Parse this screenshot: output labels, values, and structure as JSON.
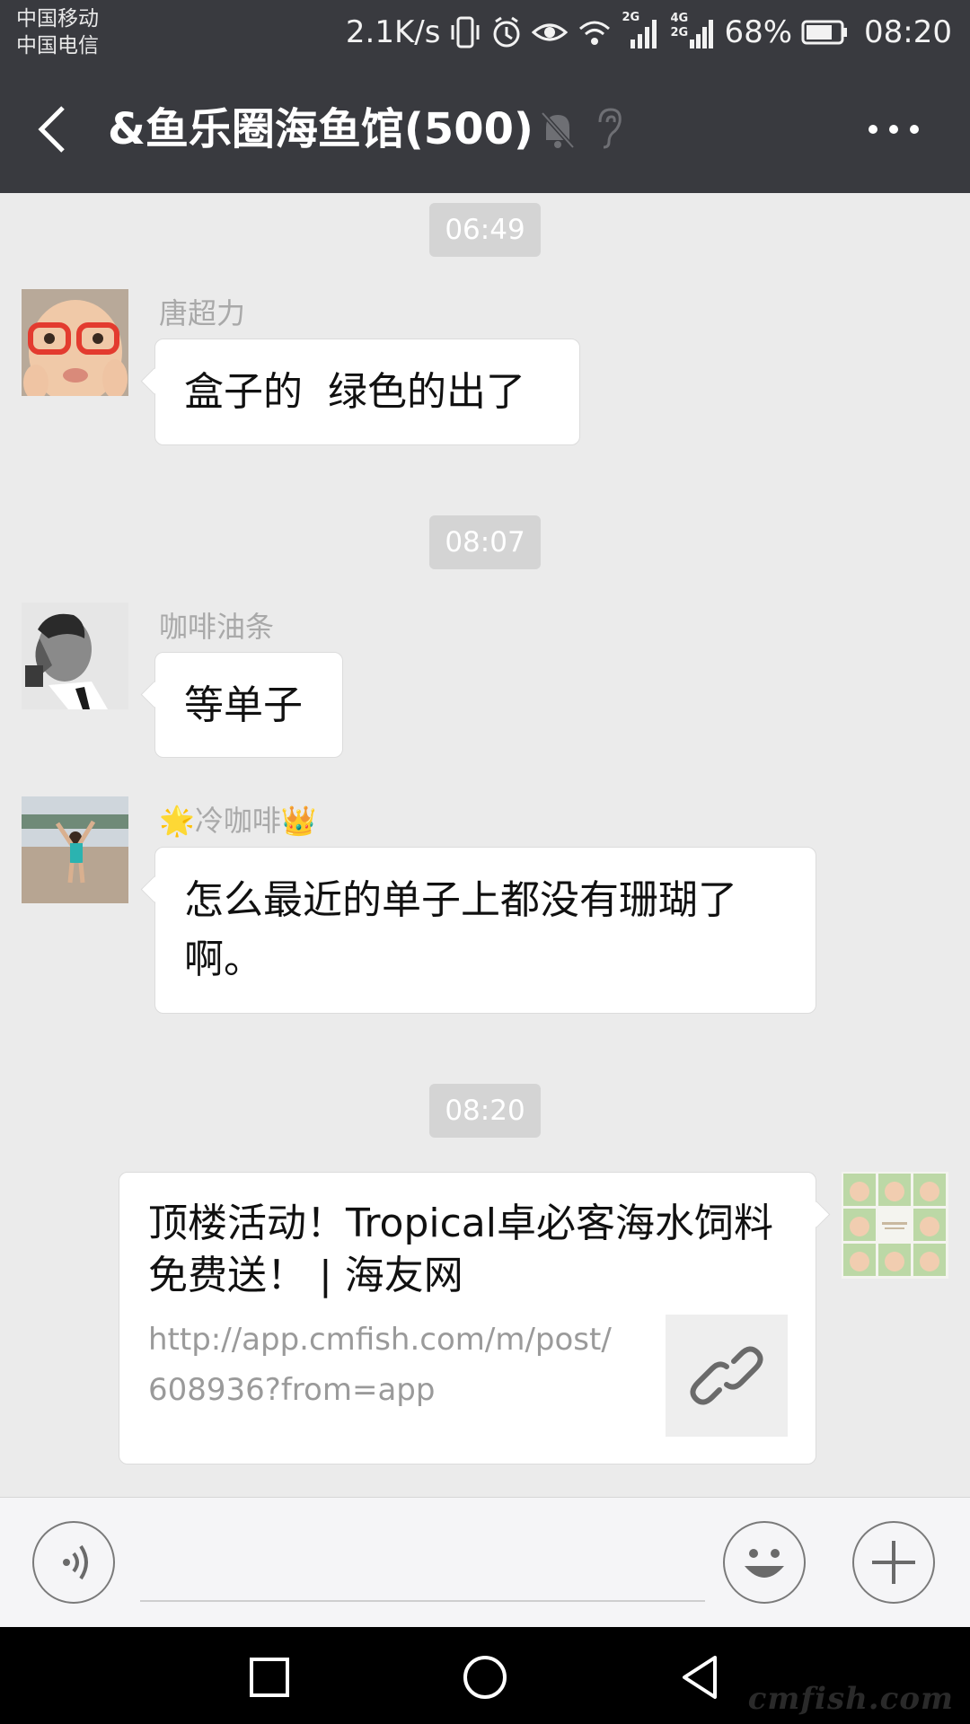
{
  "status_bar": {
    "carrier_1": "中国移动",
    "carrier_2": "中国电信",
    "net_speed": "2.1K/s",
    "sim1_tag": "2G",
    "sim2_tag_top": "4G",
    "sim2_tag_bottom": "2G",
    "battery_pct": "68%",
    "time": "08:20",
    "icons": [
      "vibrate-icon",
      "alarm-icon",
      "eye-icon",
      "wifi-icon",
      "signal-icon",
      "signal-icon",
      "battery-icon"
    ]
  },
  "header": {
    "title": "&鱼乐圈海鱼馆(500)",
    "icons": [
      "back-arrow-icon",
      "mute-bell-icon",
      "ear-icon",
      "more-dots-icon"
    ]
  },
  "chat": {
    "timestamps": [
      "06:49",
      "08:07",
      "08:20"
    ],
    "messages": [
      {
        "sender": "唐超力",
        "text": "盒子的  绿色的出了"
      },
      {
        "sender": "咖啡油条",
        "text": "等单子"
      },
      {
        "sender_star": "🌟",
        "sender": "冷咖啡",
        "sender_crown": "👑",
        "text": "怎么最近的单子上都没有珊瑚了啊。"
      }
    ],
    "link_card": {
      "title": "顶楼活动！Tropical卓必客海水饲料免费送！ | 海友网",
      "url": "http://app.cmfish.com/m/post/608936?from=app",
      "icon": "link-icon"
    }
  },
  "input_bar": {
    "placeholder": "",
    "icons": [
      "voice-icon",
      "emoji-icon",
      "plus-icon"
    ]
  },
  "nav_bar": {
    "icons": [
      "square-recents-icon",
      "circle-home-icon",
      "triangle-back-icon"
    ],
    "watermark": "cmfish.com"
  },
  "colors": {
    "header_bg": "#393a3f",
    "chat_bg": "#ebebeb",
    "bubble_bg": "#ffffff",
    "timestamp_bg": "#d4d4d4"
  }
}
